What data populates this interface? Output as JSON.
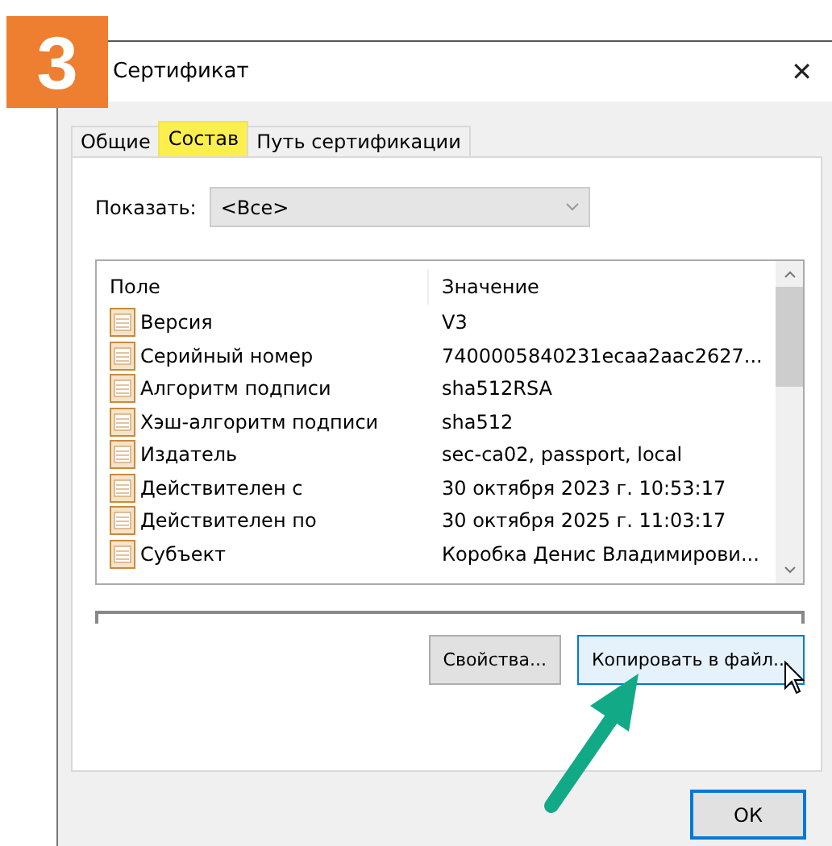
{
  "badge": "3",
  "window": {
    "title": "Сертификат",
    "close": "✕"
  },
  "tabs": [
    {
      "label": "Общие",
      "selected": false
    },
    {
      "label": "Состав",
      "selected": true
    },
    {
      "label": "Путь сертификации",
      "selected": false
    }
  ],
  "show": {
    "label": "Показать:",
    "value": "<Все>"
  },
  "table": {
    "columns": [
      "Поле",
      "Значение"
    ],
    "rows": [
      {
        "field": "Версия",
        "value": "V3"
      },
      {
        "field": "Серийный номер",
        "value": "7400005840231ecaa2aac2627..."
      },
      {
        "field": "Алгоритм подписи",
        "value": "sha512RSA"
      },
      {
        "field": "Хэш-алгоритм подписи",
        "value": "sha512"
      },
      {
        "field": "Издатель",
        "value": "sec-ca02, passport, local"
      },
      {
        "field": "Действителен с",
        "value": "30 октября 2023 г. 10:53:17"
      },
      {
        "field": "Действителен по",
        "value": "30 октября 2025 г. 11:03:17"
      },
      {
        "field": "Субъект",
        "value": "Коробка Денис Владимирови..."
      }
    ]
  },
  "buttons": [
    {
      "label": "Свойства...",
      "hovered": false
    },
    {
      "label": "Копировать в файл...",
      "hovered": true
    }
  ],
  "ok": {
    "label": "ОК",
    "default": true
  }
}
